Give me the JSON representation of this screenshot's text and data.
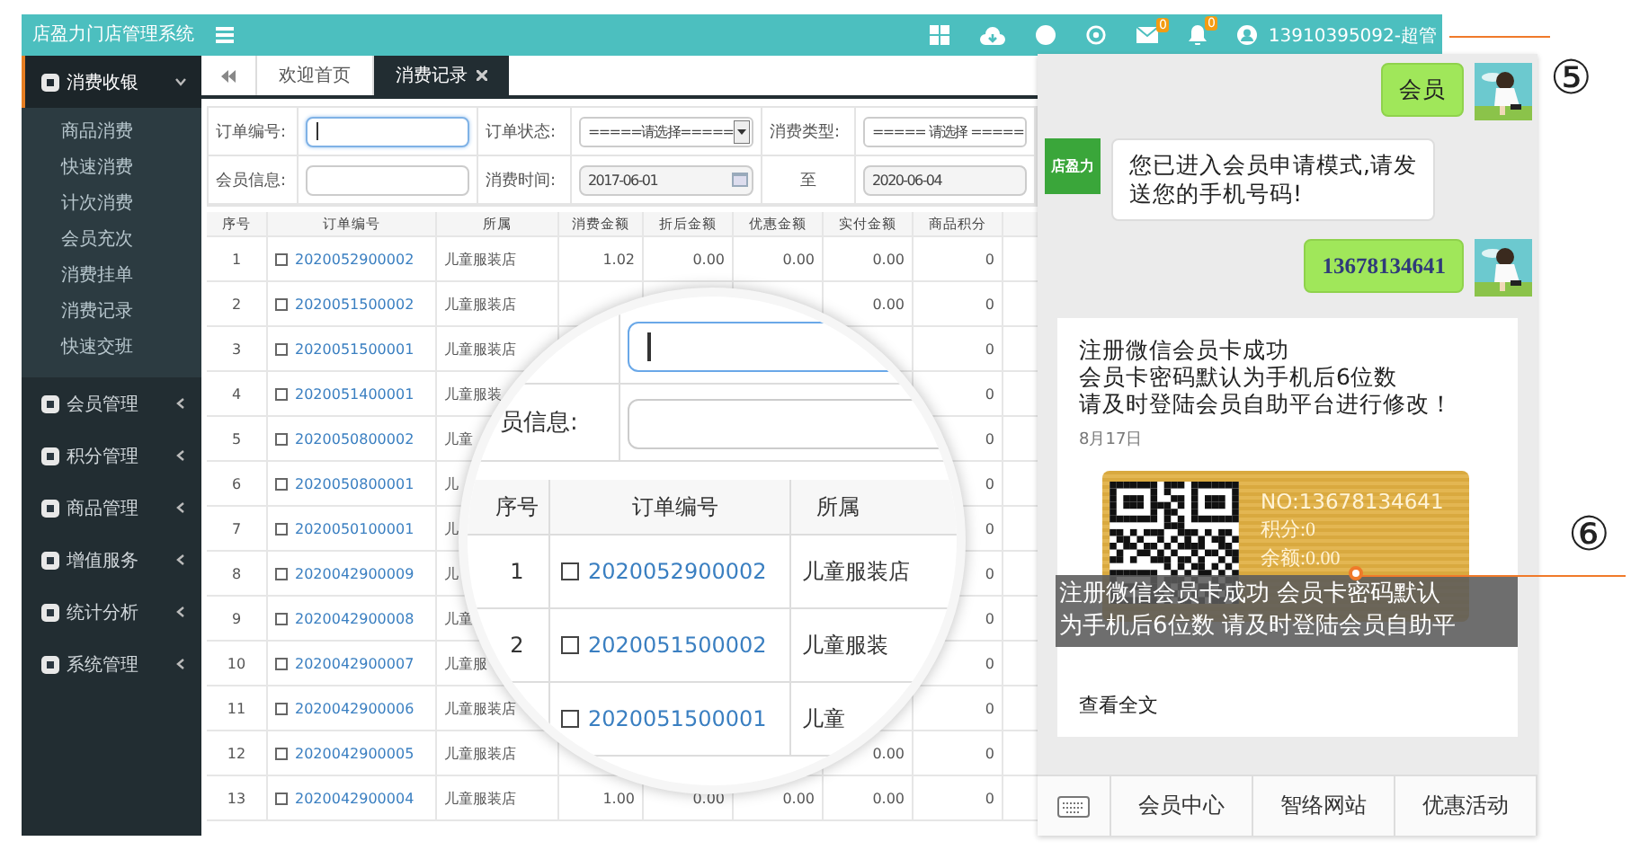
{
  "app_title": "店盈力门店管理系统",
  "top_bar": {
    "badges": [
      "0",
      "0"
    ],
    "user": "13910395092-超管"
  },
  "sidebar": {
    "items": [
      {
        "label": "消费收银",
        "expanded": true,
        "children": [
          {
            "label": "商品消费"
          },
          {
            "label": "快速消费"
          },
          {
            "label": "计次消费"
          },
          {
            "label": "会员充次"
          },
          {
            "label": "消费挂单"
          },
          {
            "label": "消费记录"
          },
          {
            "label": "快速交班"
          }
        ]
      },
      {
        "label": "会员管理",
        "expanded": false
      },
      {
        "label": "积分管理",
        "expanded": false
      },
      {
        "label": "商品管理",
        "expanded": false
      },
      {
        "label": "增值服务",
        "expanded": false
      },
      {
        "label": "统计分析",
        "expanded": false
      },
      {
        "label": "系统管理",
        "expanded": false
      }
    ]
  },
  "tabs": [
    {
      "label": "欢迎首页",
      "selected": false,
      "closable": false
    },
    {
      "label": "消费记录",
      "selected": true,
      "closable": true
    }
  ],
  "filters": [
    [
      {
        "kind": "label",
        "text": "订单编号:"
      },
      {
        "kind": "input",
        "focused": true
      },
      {
        "kind": "label",
        "text": "订单状态:"
      },
      {
        "kind": "select",
        "value": "=====请选择====="
      },
      {
        "kind": "label",
        "text": "消费类型:"
      },
      {
        "kind": "select",
        "value": "===== 请选择 ====="
      }
    ],
    [
      {
        "kind": "label",
        "text": "会员信息:"
      },
      {
        "kind": "input",
        "focused": false
      },
      {
        "kind": "label",
        "text": "消费时间:"
      },
      {
        "kind": "date",
        "value": "2017-06-01"
      },
      {
        "kind": "label",
        "text": "至"
      },
      {
        "kind": "date",
        "value": "2020-06-04"
      }
    ]
  ],
  "table": {
    "columns": [
      "序号",
      "订单编号",
      "所属",
      "消费金额",
      "折后金额",
      "优惠金额",
      "实付金额",
      "商品积分"
    ],
    "rows": [
      [
        "1",
        "2020052900002",
        "儿童服装店",
        "1.02",
        "0.00",
        "0.00",
        "0.00",
        "0"
      ],
      [
        "2",
        "2020051500002",
        "儿童服装店",
        null,
        null,
        null,
        "0.00",
        "0"
      ],
      [
        "3",
        "2020051500001",
        "儿童服装店",
        null,
        null,
        null,
        null,
        "0"
      ],
      [
        "4",
        "2020051400001",
        "儿童服装",
        null,
        null,
        null,
        null,
        "0"
      ],
      [
        "5",
        "2020050800002",
        "儿童",
        null,
        null,
        null,
        null,
        "0"
      ],
      [
        "6",
        "2020050800001",
        "儿",
        null,
        null,
        null,
        null,
        "0"
      ],
      [
        "7",
        "2020050100001",
        "儿",
        null,
        null,
        null,
        null,
        "0"
      ],
      [
        "8",
        "2020042900009",
        "儿",
        null,
        null,
        null,
        null,
        "0"
      ],
      [
        "9",
        "2020042900008",
        "儿童",
        null,
        null,
        null,
        null,
        "0"
      ],
      [
        "10",
        "2020042900007",
        "儿童服",
        null,
        null,
        null,
        null,
        "0"
      ],
      [
        "11",
        "2020042900006",
        "儿童服装店",
        null,
        null,
        null,
        null,
        "0"
      ],
      [
        "12",
        "2020042900005",
        "儿童服装店",
        null,
        null,
        null,
        "0.00",
        "0"
      ],
      [
        "13",
        "2020042900004",
        "儿童服装店",
        "1.00",
        "0.00",
        "0.00",
        "0.00",
        "0"
      ]
    ]
  },
  "magnifier": {
    "label": "员信息:",
    "columns": [
      "序号",
      "订单编号",
      "所属"
    ],
    "rows": [
      [
        "1",
        "2020052900002",
        "儿童服装店"
      ],
      [
        "2",
        "2020051500002",
        "儿童服装"
      ],
      [
        null,
        "2020051500001",
        "儿童"
      ]
    ]
  },
  "chat": {
    "shop_avatar": "店盈力",
    "messages": [
      {
        "kind": "text",
        "outgoing": true,
        "text": "会员"
      },
      {
        "kind": "text",
        "outgoing": false,
        "text": "您已进入会员申请模式,请发送您的手机号码!"
      },
      {
        "kind": "number",
        "outgoing": true,
        "text": "13678134641"
      },
      {
        "kind": "card",
        "lines": [
          "注册微信会员卡成功",
          "会员卡密码默认为手机后6位数",
          "请及时登陆会员自助平台进行修改！"
        ],
        "date": "8月17日",
        "card_lines": [
          "NO:13678134641",
          "积分:0",
          "余额:0.00"
        ],
        "caption": [
          "注册微信会员卡成功  会员卡密码默认",
          "为手机后6位数  请及时登陆会员自助平"
        ],
        "link": "查看全文"
      }
    ],
    "menu": [
      "会员中心",
      "智络网站",
      "优惠活动"
    ]
  },
  "annotations": [
    "⑤",
    "⑥"
  ]
}
